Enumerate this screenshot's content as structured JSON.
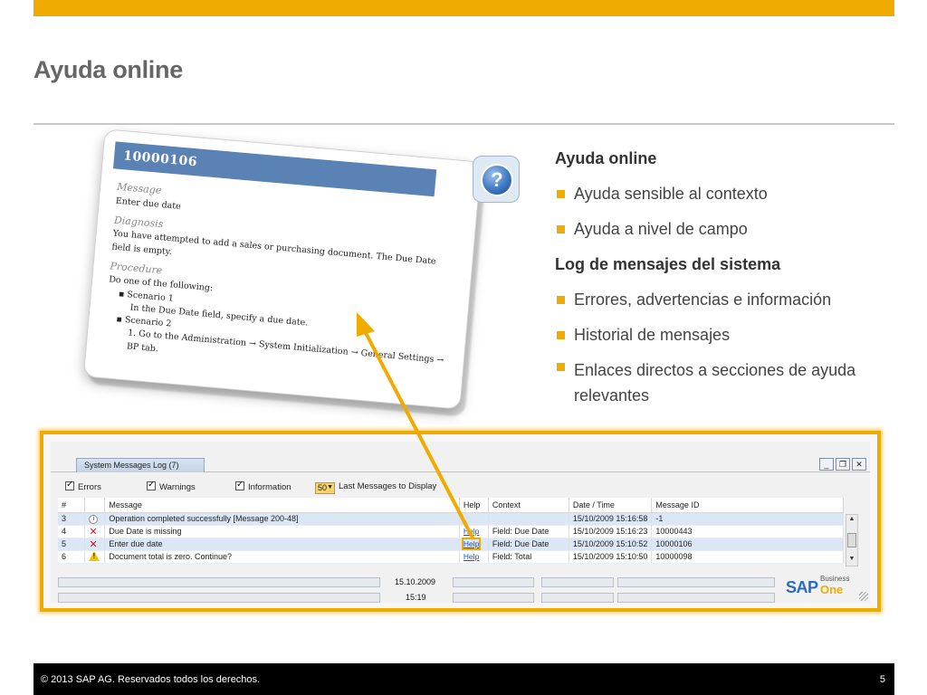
{
  "slide": {
    "title": "Ayuda online",
    "footer_copyright": "©  2013 SAP AG. Reservados todos los derechos.",
    "page_number": "5",
    "accent_color": "#f0ab00"
  },
  "help_card": {
    "message_id": "10000106",
    "message_heading": "Message",
    "message_text": "Enter due date",
    "diagnosis_heading": "Diagnosis",
    "diagnosis_text": "You have attempted to add a sales or purchasing document. The Due Date field is empty.",
    "procedure_heading": "Procedure",
    "procedure_intro": "Do one of the following:",
    "scenario1": "Scenario 1",
    "scenario1_step": "In the Due Date field, specify a due date.",
    "scenario2": "Scenario 2",
    "scenario2_step": "1.  Go to the  Administration → System Initialization → General Settings → BP tab."
  },
  "content": {
    "heading1": "Ayuda online",
    "bullet1": "Ayuda sensible al contexto",
    "bullet2": "Ayuda a nivel de campo",
    "heading2": "Log de mensajes del sistema",
    "bullet3": "Errores, advertencias e información",
    "bullet4": "Historial de mensajes",
    "bullet5": "Enlaces directos a secciones de ayuda relevantes"
  },
  "window": {
    "tab_label": "System Messages Log (7)",
    "filter_errors": "Errors",
    "filter_warnings": "Warnings",
    "filter_information": "Information",
    "messages_count": "50",
    "messages_label": "Last Messages to Display",
    "columns": {
      "num": "#",
      "message": "Message",
      "help": "Help",
      "context": "Context",
      "datetime": "Date / Time",
      "message_id": "Message ID"
    },
    "rows": [
      {
        "num": "3",
        "type": "info",
        "message": "Operation completed successfully  [Message 200-48]",
        "help": "",
        "context": "",
        "datetime": "15/10/2009  15:16:58",
        "message_id": "-1"
      },
      {
        "num": "4",
        "type": "error",
        "message": "Due Date is missing",
        "help": "Help",
        "context": "Field: Due Date",
        "datetime": "15/10/2009  15:16:23",
        "message_id": "10000443"
      },
      {
        "num": "5",
        "type": "error",
        "message": "Enter due date",
        "help": "Help",
        "context": "Field: Due Date",
        "datetime": "15/10/2009  15:10:52",
        "message_id": "10000106"
      },
      {
        "num": "6",
        "type": "warning",
        "message": "Document total is zero. Continue?",
        "help": "Help",
        "context": "Field: Total",
        "datetime": "15/10/2009  15:10:50",
        "message_id": "10000098"
      }
    ],
    "status_date": "15.10.2009",
    "status_time": "15:19",
    "logo_sap": "SAP",
    "logo_business": "Business",
    "logo_one": "One"
  }
}
